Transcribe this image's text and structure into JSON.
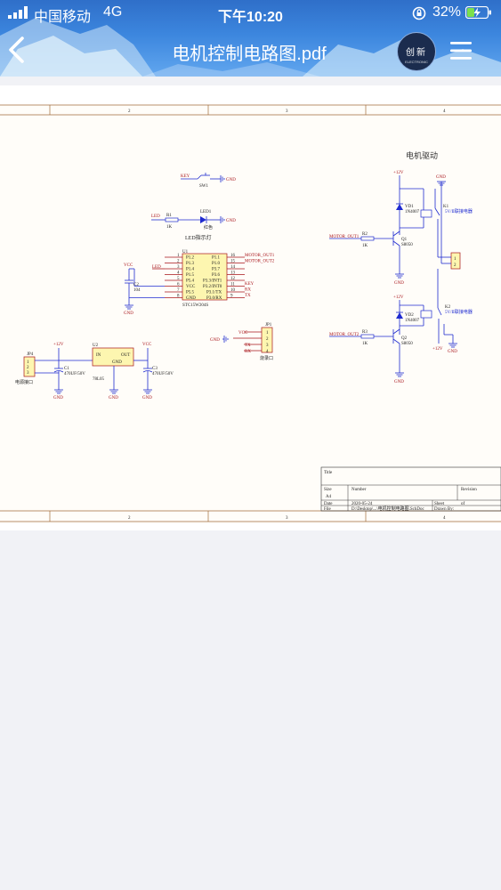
{
  "status_bar": {
    "carrier": "中国移动",
    "network": "4G",
    "time": "下午10:20",
    "battery_percent": "32%"
  },
  "header": {
    "title": "电机控制电路图.pdf",
    "avatar_line1": "创新",
    "avatar_line2": "ELECTRONIC",
    "back_icon": "chevron-left-icon",
    "menu_icon": "hamburger-menu-icon"
  },
  "document": {
    "ruler": [
      "2",
      "3",
      "4"
    ],
    "motor_section_title": "电机驱动",
    "key_label": "KEY",
    "sw1": "SW1",
    "gnd": "GND",
    "led_label": "LED",
    "r1": "R1",
    "r1_val": "1K",
    "led1": "LED1",
    "led1_color": "红色",
    "led_indicator": "LED指示灯",
    "u1": "U1",
    "mcu": "STC15W204S",
    "vcc": "VCC",
    "c2": "C2",
    "c2_val": "104",
    "pins_left": [
      "P1.2",
      "P1.3",
      "P1.4",
      "P1.5",
      "P5.4",
      "VCC",
      "P5.5",
      "GND"
    ],
    "pins_right": [
      "P1.1",
      "P1.0",
      "P3.7",
      "P3.6",
      "P3.3/INT1",
      "P3.2/INT0",
      "P3.1/TX",
      "P3.0/RX"
    ],
    "pin_nums_left": [
      "1",
      "2",
      "3",
      "4",
      "5",
      "6",
      "7",
      "8"
    ],
    "pin_nums_right": [
      "16",
      "15",
      "14",
      "13",
      "12",
      "11",
      "10",
      "9"
    ],
    "net_right": [
      "MOTOR_OUT1",
      "MOTOR_OUT2",
      "",
      "",
      "KEY",
      "RX",
      "TX"
    ],
    "jp1": "JP1",
    "jp1_pins": [
      "1",
      "2",
      "3",
      "4"
    ],
    "jp1_nets": [
      "VCC",
      "",
      "TX",
      "RX"
    ],
    "jp1_label": "烧录口",
    "jp4": "JP4",
    "jp4_pins": [
      "1",
      "2",
      "3"
    ],
    "jp4_label": "电源接口",
    "v12": "+12V",
    "c1": "C1",
    "c1_val": "470UF/50V",
    "u2": "U2",
    "u2_in": "IN",
    "u2_out": "OUT",
    "u2_gnd": "GND",
    "u2_part": "78L05",
    "c3": "C3",
    "c3_val": "470UF/50V",
    "vd1": "VD1",
    "vd_part": "1N4007",
    "k1": "K1",
    "relay_part": "5V/Ⅱ联接电器",
    "r2": "R2",
    "r2_val": "1K",
    "q1": "Q1",
    "q_part": "S8050",
    "motor_out1": "MOTOR_OUT1",
    "motor_conn_pins": [
      "1",
      "2"
    ],
    "vd2": "VD2",
    "k2": "K2",
    "r3": "R3",
    "r3_val": "1K",
    "q2": "Q2",
    "motor_out2": "MOTOR_OUT2",
    "tb_title": "Title",
    "tb_size": "Size",
    "tb_size_val": "A4",
    "tb_number": "Number",
    "tb_revision": "Revision",
    "tb_date": "Date",
    "tb_date_val": "2020-05-24",
    "tb_file": "File",
    "tb_file_val": "D:\\Desktop\\...\\电机控制电路图.SchDoc",
    "tb_sheet": "Sheet",
    "tb_of": "of",
    "tb_drawn": "Drawn By:"
  },
  "colors": {
    "header_blue": "#3c86de",
    "wire_blue": "#1f2bd0",
    "net_red": "#a8141a",
    "component_yellow": "#fdf6b0",
    "component_border": "#a8141a"
  }
}
